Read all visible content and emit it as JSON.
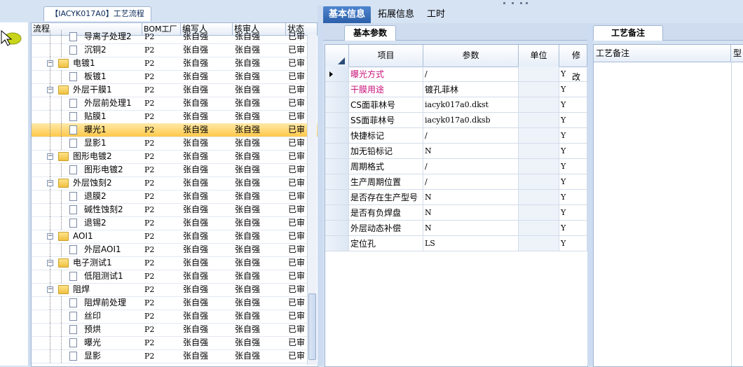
{
  "process_panel": {
    "title": "【IACYK017A0】工艺流程",
    "columns": [
      "流程",
      "BOM工厂",
      "编写人",
      "核审人",
      "状态"
    ],
    "rows": [
      {
        "name": "导离子处理2",
        "level": 2,
        "type": "doc",
        "bom": "P2",
        "writer": "张自强",
        "reviewer": "张自强",
        "status": "已审"
      },
      {
        "name": "沉铜2",
        "level": 2,
        "type": "doc",
        "bom": "P2",
        "writer": "张自强",
        "reviewer": "张自强",
        "status": "已审"
      },
      {
        "name": "电镀1",
        "level": 1,
        "type": "folder",
        "bom": "P2",
        "writer": "张自强",
        "reviewer": "张自强",
        "status": "已审"
      },
      {
        "name": "板镀1",
        "level": 2,
        "type": "doc",
        "bom": "P2",
        "writer": "张自强",
        "reviewer": "张自强",
        "status": "已审"
      },
      {
        "name": "外层干膜1",
        "level": 1,
        "type": "folder",
        "bom": "P2",
        "writer": "张自强",
        "reviewer": "张自强",
        "status": "已审"
      },
      {
        "name": "外层前处理1",
        "level": 2,
        "type": "doc",
        "bom": "P2",
        "writer": "张自强",
        "reviewer": "张自强",
        "status": "已审"
      },
      {
        "name": "贴膜1",
        "level": 2,
        "type": "doc",
        "bom": "P2",
        "writer": "张自强",
        "reviewer": "张自强",
        "status": "已审"
      },
      {
        "name": "曝光1",
        "level": 2,
        "type": "doc",
        "bom": "P2",
        "writer": "张自强",
        "reviewer": "张自强",
        "status": "已审",
        "selected": true
      },
      {
        "name": "显影1",
        "level": 2,
        "type": "doc",
        "bom": "P2",
        "writer": "张自强",
        "reviewer": "张自强",
        "status": "已审"
      },
      {
        "name": "图形电镀2",
        "level": 1,
        "type": "folder",
        "bom": "P2",
        "writer": "张自强",
        "reviewer": "张自强",
        "status": "已审"
      },
      {
        "name": "图形电镀2",
        "level": 2,
        "type": "doc",
        "bom": "P2",
        "writer": "张自强",
        "reviewer": "张自强",
        "status": "已审"
      },
      {
        "name": "外层蚀刻2",
        "level": 1,
        "type": "folder",
        "bom": "P2",
        "writer": "张自强",
        "reviewer": "张自强",
        "status": "已审"
      },
      {
        "name": "退膜2",
        "level": 2,
        "type": "doc",
        "bom": "P2",
        "writer": "张自强",
        "reviewer": "张自强",
        "status": "已审"
      },
      {
        "name": "碱性蚀刻2",
        "level": 2,
        "type": "doc",
        "bom": "P2",
        "writer": "张自强",
        "reviewer": "张自强",
        "status": "已审"
      },
      {
        "name": "退锡2",
        "level": 2,
        "type": "doc",
        "bom": "P2",
        "writer": "张自强",
        "reviewer": "张自强",
        "status": "已审"
      },
      {
        "name": "AOI1",
        "level": 1,
        "type": "folder",
        "bom": "P2",
        "writer": "张自强",
        "reviewer": "张自强",
        "status": "已审"
      },
      {
        "name": "外层AOI1",
        "level": 2,
        "type": "doc",
        "bom": "P2",
        "writer": "张自强",
        "reviewer": "张自强",
        "status": "已审"
      },
      {
        "name": "电子测试1",
        "level": 1,
        "type": "folder",
        "bom": "P2",
        "writer": "张自强",
        "reviewer": "张自强",
        "status": "已审"
      },
      {
        "name": "低阻测试1",
        "level": 2,
        "type": "doc",
        "bom": "P2",
        "writer": "张自强",
        "reviewer": "张自强",
        "status": "已审"
      },
      {
        "name": "阻焊",
        "level": 1,
        "type": "folder",
        "bom": "P2",
        "writer": "张自强",
        "reviewer": "张自强",
        "status": "已审"
      },
      {
        "name": "阻焊前处理",
        "level": 2,
        "type": "doc",
        "bom": "P2",
        "writer": "张自强",
        "reviewer": "张自强",
        "status": "已审"
      },
      {
        "name": "丝印",
        "level": 2,
        "type": "doc",
        "bom": "P2",
        "writer": "张自强",
        "reviewer": "张自强",
        "status": "已审"
      },
      {
        "name": "预烘",
        "level": 2,
        "type": "doc",
        "bom": "P2",
        "writer": "张自强",
        "reviewer": "张自强",
        "status": "已审"
      },
      {
        "name": "曝光",
        "level": 2,
        "type": "doc",
        "bom": "P2",
        "writer": "张自强",
        "reviewer": "张自强",
        "status": "已审"
      },
      {
        "name": "显影",
        "level": 2,
        "type": "doc",
        "bom": "P2",
        "writer": "张自强",
        "reviewer": "张自强",
        "status": "已审"
      }
    ]
  },
  "tabs": [
    "基本信息",
    "拓展信息",
    "工时"
  ],
  "active_tab": 0,
  "params_panel": {
    "subtab": "基本参数",
    "columns": [
      "项目",
      "参数",
      "单位",
      "修改"
    ],
    "rows": [
      {
        "item": "曝光方式",
        "value": "/",
        "unit": "",
        "mod": "Y",
        "highlight": "magenta"
      },
      {
        "item": "干膜用途",
        "value": "镀孔菲林",
        "unit": "",
        "mod": "Y",
        "highlight": "magenta"
      },
      {
        "item": "CS面菲林号",
        "value": "iacyk017a0.dkst",
        "unit": "",
        "mod": "Y"
      },
      {
        "item": "SS面菲林号",
        "value": "iacyk017a0.dksb",
        "unit": "",
        "mod": "Y"
      },
      {
        "item": "快捷标记",
        "value": "/",
        "unit": "",
        "mod": "Y"
      },
      {
        "item": "加无铅标记",
        "value": "N",
        "unit": "",
        "mod": "Y"
      },
      {
        "item": "周期格式",
        "value": "/",
        "unit": "",
        "mod": "Y"
      },
      {
        "item": "生产周期位置",
        "value": "/",
        "unit": "",
        "mod": "Y"
      },
      {
        "item": "是否存在生产型号",
        "value": "N",
        "unit": "",
        "mod": "Y"
      },
      {
        "item": "是否有负焊盘",
        "value": "N",
        "unit": "",
        "mod": "Y"
      },
      {
        "item": "外层动态补偿",
        "value": "N",
        "unit": "",
        "mod": "Y"
      },
      {
        "item": "定位孔",
        "value": "LS",
        "unit": "",
        "mod": "Y"
      }
    ]
  },
  "notes_panel": {
    "subtab": "工艺备注",
    "columns": [
      "工艺备注",
      "型"
    ]
  },
  "colors": {
    "accent": "#2c5fa9",
    "selected_row": "#ffc94a",
    "highlight_text": "#c8127a"
  }
}
